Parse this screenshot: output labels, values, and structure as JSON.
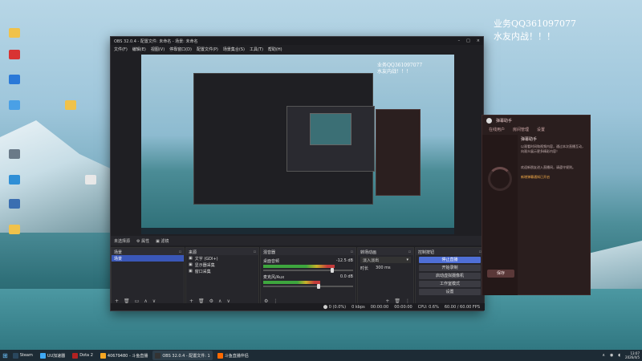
{
  "watermark": {
    "line1": "业务QQ361097077",
    "line2": "水友内战！！！"
  },
  "desktop_icons": [
    {
      "label": "",
      "color": "#f0c24b"
    },
    {
      "label": "",
      "color": "#d83333"
    },
    {
      "label": "",
      "color": "#2a79d8"
    },
    {
      "label": "",
      "color": "#4aa0e6"
    },
    {
      "label": "",
      "color": "#6a7a88"
    },
    {
      "label": "",
      "color": "#2f8fd6"
    },
    {
      "label": "",
      "color": "#3b6fb1"
    },
    {
      "label": "",
      "color": "#f0c24b"
    },
    {
      "label": "",
      "color": "#f0c24b"
    },
    {
      "label": "",
      "color": "#e8e8e8"
    }
  ],
  "obs": {
    "title": "OBS 32.0.4 - 配置文件: 未命名 - 场景: 未命名",
    "menu": [
      "文件(F)",
      "编辑(E)",
      "视图(V)",
      "停靠窗口(D)",
      "配置文件(P)",
      "场景集合(S)",
      "工具(T)",
      "帮助(H)"
    ],
    "window_controls": [
      "–",
      "□",
      "×"
    ],
    "nested_watermark": {
      "line1": "业务QQ361097077",
      "line2": "水友内战！！！"
    },
    "source_bar": [
      "未选择源",
      "⚙ 属性",
      "▣ 滤镜"
    ],
    "scenes": {
      "title": "场景",
      "items": [
        "场景"
      ]
    },
    "sources": {
      "title": "来源",
      "items": [
        "文字 (GDI+)",
        "显示器采集",
        "窗口采集"
      ]
    },
    "mixer": {
      "title": "混音器",
      "tracks": [
        {
          "name": "桌面音频",
          "db": "-12.5 dB",
          "level": 0.75
        },
        {
          "name": "麦克风/Aux",
          "db": "0.0 dB",
          "level": 0.6
        }
      ]
    },
    "transitions": {
      "title": "转场动画",
      "type": "淡入淡出",
      "duration_label": "时长",
      "duration": "300 ms"
    },
    "controls": {
      "title": "控制按钮",
      "buttons": [
        "停止直播",
        "开始录制",
        "启动虚拟摄像机",
        "工作室模式",
        "设置"
      ]
    },
    "status": [
      "⬤ 0 (0.0%)",
      "0 kbps",
      "00:00:00",
      "00:00:00",
      "CPU: 0.6%",
      "60.00 / 60.00 FPS"
    ]
  },
  "chat": {
    "title": "弹幕助手",
    "tabs": [
      "在线用户",
      "房间管理",
      "设置"
    ],
    "section": "弹幕助手",
    "lines": [
      "以观看时间和视频内容，通过本次直播互动，",
      "向观众展示更多精彩内容！",
      "欢迎新朋友进入直播间，请遵守规则。"
    ],
    "highlight": "新增弹幕通知已开启",
    "button": "保存"
  },
  "taskbar": {
    "items": [
      {
        "label": "Steam",
        "color": "#2a475e",
        "active": false
      },
      {
        "label": "UU加速器",
        "color": "#3fa9f5",
        "active": false
      },
      {
        "label": "Dota 2",
        "color": "#b22222",
        "active": false
      },
      {
        "label": "40679480 - 斗鱼直播",
        "color": "#f5a623",
        "active": false
      },
      {
        "label": "OBS 32.0.4 - 配置文件: 1",
        "color": "#333333",
        "active": true
      },
      {
        "label": "斗鱼直播伴侣",
        "color": "#ff6a00",
        "active": false
      }
    ],
    "time": "13:07",
    "date": "2026/4/5"
  }
}
